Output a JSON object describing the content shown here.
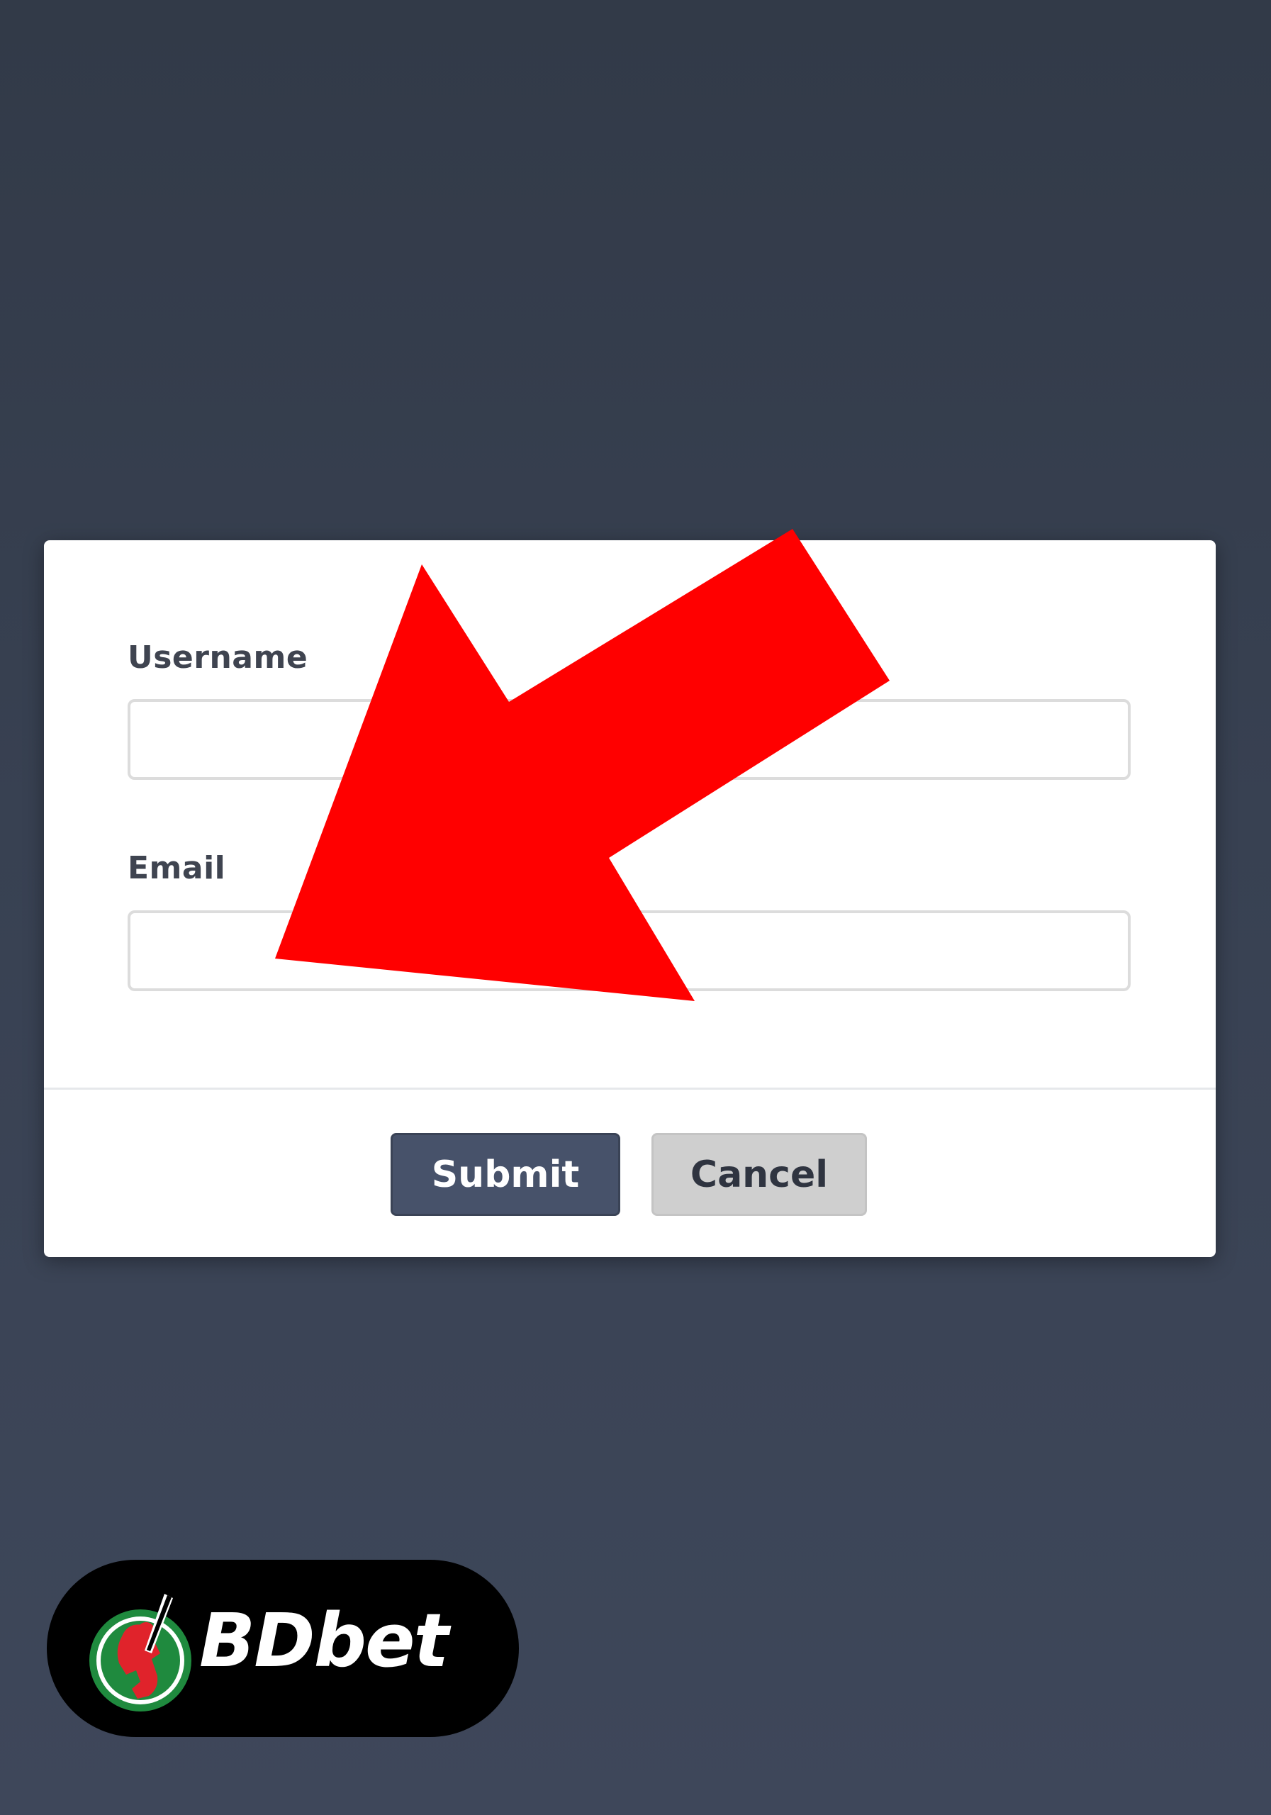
{
  "form": {
    "username_label": "Username",
    "username_value": "",
    "email_label": "Email",
    "email_value": ""
  },
  "actions": {
    "submit_label": "Submit",
    "cancel_label": "Cancel"
  },
  "overlay": {
    "arrow_icon": "red-arrow-pointer-icon",
    "arrow_color": "#ff0000"
  },
  "brand": {
    "name": "BDbet",
    "logo_icon": "cricket-batsman-logo-icon",
    "colors": {
      "badge": "#000000",
      "logo_green": "#1f8a3e",
      "logo_red": "#e0232b"
    }
  },
  "theme": {
    "background": "#384152",
    "dialog": "#ffffff",
    "submit_button": "#47526a",
    "cancel_button": "#cfcfcf"
  }
}
